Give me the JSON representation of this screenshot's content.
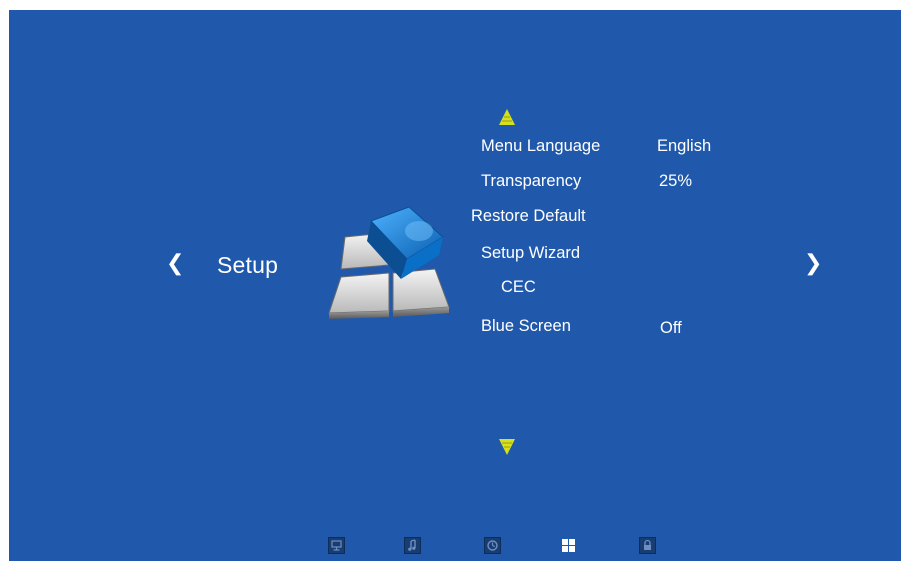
{
  "page": {
    "section_title": "Setup"
  },
  "navigation": {
    "prev_icon": "chevron-left-icon",
    "next_icon": "chevron-right-icon",
    "scroll_up_icon": "triangle-up-icon",
    "scroll_down_icon": "triangle-down-icon",
    "arrow_color": "#d6e01e"
  },
  "menu": {
    "items": [
      {
        "label": "Menu Language",
        "value": "English"
      },
      {
        "label": "Transparency",
        "value": "25%"
      },
      {
        "label": "Restore Default",
        "value": ""
      },
      {
        "label": "Setup Wizard",
        "value": ""
      },
      {
        "label": "CEC",
        "value": ""
      },
      {
        "label": "Blue Screen",
        "value": "Off"
      }
    ]
  },
  "bottom_tabs": [
    {
      "icon": "monitor-icon",
      "active": false
    },
    {
      "icon": "music-icon",
      "active": false
    },
    {
      "icon": "clock-icon",
      "active": false
    },
    {
      "icon": "grid-icon",
      "active": true
    },
    {
      "icon": "lock-icon",
      "active": false
    }
  ],
  "colors": {
    "background": "#2059ac",
    "text": "#ffffff",
    "tab_inactive": "#173d73",
    "tab_active": "#ffffff"
  }
}
